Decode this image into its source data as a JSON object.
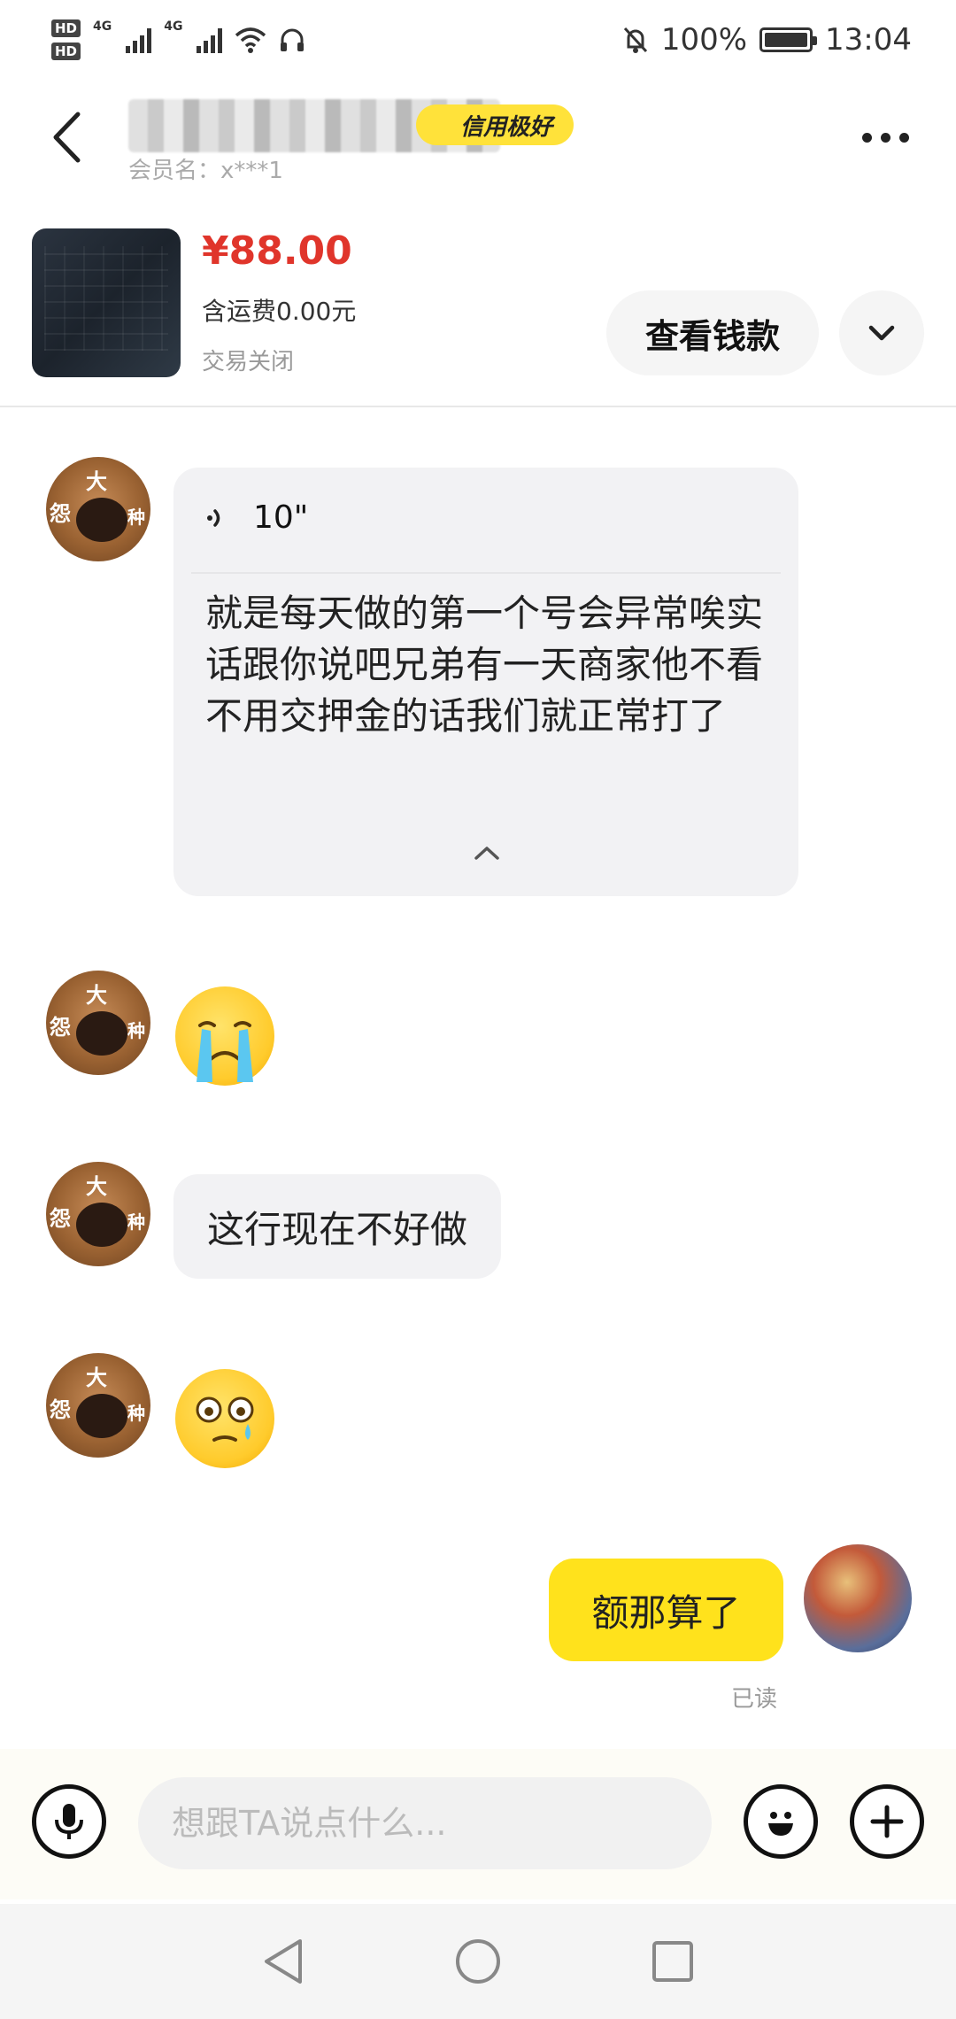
{
  "status_bar": {
    "hd1": "HD",
    "hd2": "HD",
    "net1": "4G",
    "net2": "4G",
    "battery_percent": "100%",
    "time": "13:04"
  },
  "header": {
    "credit_badge": "信用极好",
    "member_name": "会员名：x***1"
  },
  "product": {
    "price": "¥88.00",
    "shipping": "含运费0.00元",
    "status": "交易关闭",
    "view_money_button": "查看钱款"
  },
  "messages": {
    "voice": {
      "duration": "10\"",
      "transcript": "就是每天做的第一个号会异常唉实话跟你说吧兄弟有一天商家他不看不用交押金的话我们就正常打了"
    },
    "avatar_chars": [
      "大",
      "怨",
      "种"
    ],
    "text1": "这行现在不好做",
    "mine": "额那算了",
    "read_status": "已读"
  },
  "input": {
    "placeholder": "想跟TA说点什么..."
  }
}
